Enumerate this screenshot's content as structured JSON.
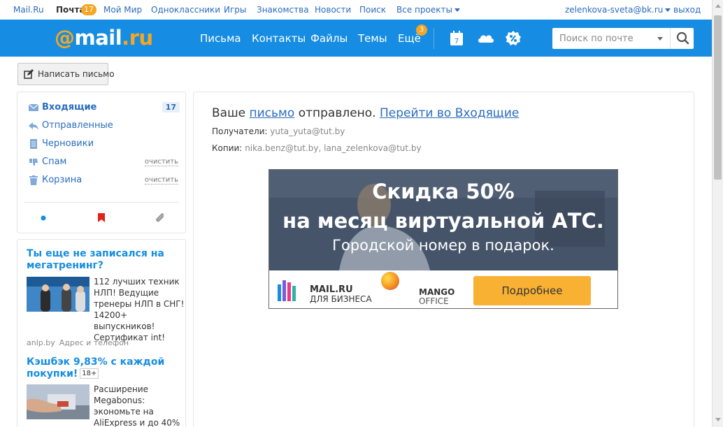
{
  "portal": {
    "links": [
      {
        "label": "Mail.Ru"
      },
      {
        "label": "Почта",
        "badge": "17"
      },
      {
        "label": "Мой Мир"
      },
      {
        "label": "Одноклассники"
      },
      {
        "label": "Игры"
      },
      {
        "label": "Знакомства"
      },
      {
        "label": "Новости"
      },
      {
        "label": "Поиск"
      },
      {
        "label": "Все проекты"
      }
    ],
    "user_email": "zelenkova-sveta@bk.ru",
    "logout": "выход"
  },
  "header": {
    "logo_at": "@",
    "logo_mail": "mail",
    "logo_dot": ".",
    "logo_ru": "ru",
    "nav": [
      {
        "label": "Письма"
      },
      {
        "label": "Контакты"
      },
      {
        "label": "Файлы"
      },
      {
        "label": "Темы"
      },
      {
        "label": "Ещё",
        "badge": "3"
      }
    ],
    "calendar_day": "7",
    "icons": [
      "calendar-icon",
      "cloud-icon",
      "discount-icon"
    ],
    "search_placeholder": "Поиск по почте"
  },
  "compose": {
    "label": "Написать письмо"
  },
  "folders": [
    {
      "name": "Входящие",
      "icon": "inbox-icon",
      "count": "17",
      "active": true
    },
    {
      "name": "Отправленные",
      "icon": "sent-icon"
    },
    {
      "name": "Черновики",
      "icon": "drafts-icon"
    },
    {
      "name": "Спам",
      "icon": "spam-icon",
      "action": "очистить"
    },
    {
      "name": "Корзина",
      "icon": "trash-icon",
      "action": "очистить"
    }
  ],
  "filters": [
    "unread-dot-icon",
    "flag-icon",
    "attachment-icon"
  ],
  "ads": [
    {
      "title": "Ты еще не записался на мегатренинг?",
      "text": "112 лучших техник НЛП! Ведущие тренеры НЛП в СНГ! 14200+ выпускников! Сертификат int!",
      "domain": "anlp.by",
      "sub": "Адрес и телефон"
    },
    {
      "title": "Кэшбэк 9,83% с каждой покупки!",
      "age": "18+",
      "text": "Расширение Megabonus: экономьте на AliExpress и до 40% -"
    }
  ],
  "message": {
    "prefix": "Ваше",
    "link": "письмо",
    "suffix": "отправлено.",
    "goto": "Перейти во Входящие",
    "recipients_label": "Получатели:",
    "recipients": "yuta_yuta@tut.by",
    "cc_label": "Копии:",
    "cc": "nika.benz@tut.by, lana_zelenkova@tut.by"
  },
  "banner": {
    "line1": "Скидка 50%",
    "line2": "на месяц виртуальной АТС.",
    "line3": "Городской номер в подарок.",
    "brand1": "MAIL.RU",
    "brand1_sub": "ДЛЯ БИЗНЕСА",
    "brand2": "MANGO",
    "brand2_sub": "OFFICE",
    "button": "Подробнее"
  },
  "colors": {
    "accent_blue": "#168de2",
    "orange": "#f5a623",
    "link": "#2a6cbf"
  }
}
